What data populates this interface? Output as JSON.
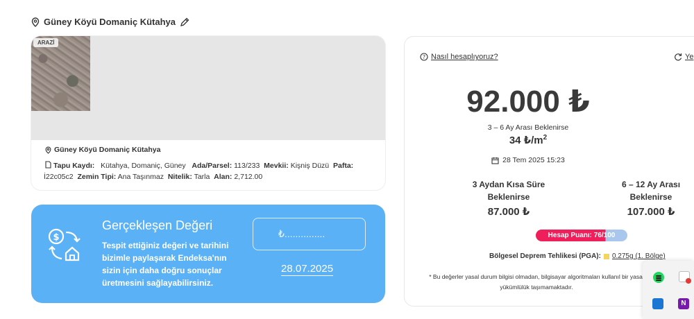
{
  "header": {
    "location_title": "Güney Köyü Domaniç Kütahya"
  },
  "property": {
    "photo_badge": "ARAZİ",
    "location": "Güney Köyü Domaniç Kütahya",
    "labels": {
      "tapu": "Tapu Kaydı:",
      "ada": "Ada/Parsel:",
      "mevkii": "Mevkii:",
      "pafta": "Pafta:",
      "zemin": "Zemin Tipi:",
      "nitelik": "Nitelik:",
      "alan": "Alan:"
    },
    "values": {
      "tapu": "Kütahya, Domaniç, Güney",
      "ada": "113/233",
      "mevkii": "Kişniş Düzü",
      "pafta": "İ22c05c2",
      "zemin": "Ana Taşınmaz",
      "nitelik": "Tarla",
      "alan": "2,712.00"
    }
  },
  "realized": {
    "title": "Gerçekleşen Değeri",
    "description": "Tespit ettiğiniz değeri ve tarihini bizimle paylaşarak Endeksa'nın sizin için daha doğru sonuçlar üretmesini sağlayabilirsiniz.",
    "input_placeholder": "₺...............",
    "date": "28.07.2025"
  },
  "valuation": {
    "how_link": "Nasıl hesaplıyoruz?",
    "refresh_label": "Ye",
    "price": "92.000 ₺",
    "price_note": "3 – 6 Ay Arası Beklenirse",
    "per_m2": "34 ₺/m",
    "per_m2_sup": "2",
    "date": "28 Tem 2025 15:23",
    "short": {
      "label_line1": "3 Aydan Kısa Süre",
      "label_line2": "Beklenirse",
      "amount": "87.000 ₺"
    },
    "long": {
      "label_line1": "6 – 12 Ay Arası",
      "label_line2": "Beklenirse",
      "amount": "107.000 ₺"
    },
    "score": {
      "label": "Hesap Puanı: 76/100",
      "value": 76,
      "max": 100
    },
    "quake_label": "Bölgesel Deprem Tehlikesi (PGA):",
    "quake_value": "0.275g (1. Bölge)",
    "disclaimer": "* Bu değerler yasal durum bilgisi olmadan, bilgisayar algoritmaları kullanıl bir yasal yükümlülük taşımamaktadır."
  },
  "tray": {
    "onenote_letter": "N"
  },
  "colors": {
    "accent_blue": "#5bb1f5",
    "score_red": "#ee1f5a",
    "score_rest": "#a9c7ec"
  }
}
